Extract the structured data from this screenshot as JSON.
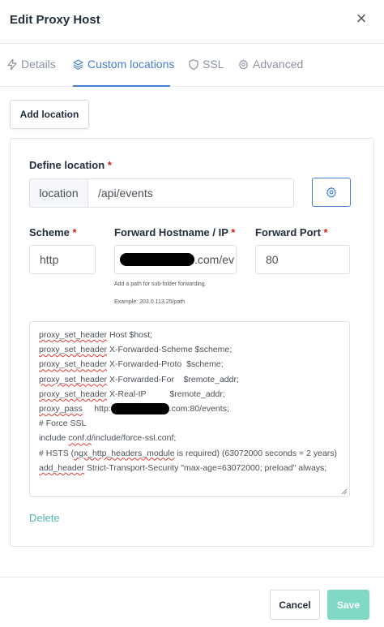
{
  "modal": {
    "title": "Edit Proxy Host",
    "close": "×"
  },
  "tabs": [
    {
      "label": "Details",
      "icon": "bolt-icon",
      "active": false
    },
    {
      "label": "Custom locations",
      "icon": "layers-icon",
      "active": true
    },
    {
      "label": "SSL",
      "icon": "shield-icon",
      "active": false
    },
    {
      "label": "Advanced",
      "icon": "gear-icon",
      "active": false
    }
  ],
  "add_location_label": "Add location",
  "location": {
    "define_label": "Define location",
    "required_mark": "*",
    "prefix": "location",
    "path": "/api/events",
    "scheme_label": "Scheme",
    "scheme_value": "http",
    "hostname_label": "Forward Hostname / IP",
    "hostname_suffix": ".com/ev",
    "port_label": "Forward Port",
    "port_value": "80",
    "help_text": "Add a path for sub-folder forwarding.",
    "help_example": "Example: 203.0.113.25/path"
  },
  "config_lines": [
    [
      "proxy_set_header",
      " Host $host;"
    ],
    [
      "proxy_set_header",
      " X-Forwarded-Scheme $scheme;"
    ],
    [
      "proxy_set_header",
      " X-Forwarded-Proto  $scheme;"
    ],
    [
      "proxy_set_header",
      " X-Forwarded-For    $remote_addr;"
    ],
    [
      "proxy_set_header",
      " X-Real-IP          $remote_addr;"
    ]
  ],
  "config": {
    "proxy_pass_kw": "proxy_pass",
    "proxy_pass_prefix": "http:",
    "proxy_pass_suffix": ".com:80/events;",
    "force_ssl_comment": "# Force SSL",
    "include_kw": "include ",
    "include_path": "conf.d",
    "include_rest": "/include/force-ssl.conf",
    "include_end": ";",
    "hsts_comment_a": "# HSTS (",
    "hsts_module": "ngx_http_headers_module",
    "hsts_comment_b": " is required) (63072000 seconds = 2 years)",
    "add_header_kw": "add_header",
    "add_header_rest": " Strict-Transport-Security \"max-age=63072000; preload\" always;"
  },
  "delete_label": "Delete",
  "footer": {
    "cancel_label": "Cancel",
    "save_label": "Save"
  },
  "colors": {
    "accent": "#467fcf",
    "save": "#7fd9c5",
    "delete_link": "#4fb6ac",
    "required": "#cd201f"
  }
}
